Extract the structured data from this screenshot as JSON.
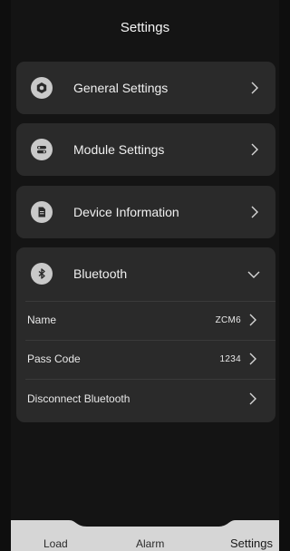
{
  "header": {
    "title": "Settings"
  },
  "menu": {
    "general": {
      "label": "General Settings",
      "icon": "gear-icon"
    },
    "module": {
      "label": "Module Settings",
      "icon": "toggle-icon"
    },
    "device": {
      "label": "Device Information",
      "icon": "document-icon"
    },
    "bluetooth": {
      "label": "Bluetooth",
      "icon": "bluetooth-icon",
      "expanded": true,
      "items": [
        {
          "label": "Name",
          "value": "ZCM6"
        },
        {
          "label": "Pass Code",
          "value": "1234"
        },
        {
          "label": "Disconnect Bluetooth",
          "value": ""
        }
      ]
    }
  },
  "tabs": [
    {
      "label": "Load",
      "active": false
    },
    {
      "label": "Alarm",
      "active": false
    },
    {
      "label": "Settings",
      "active": true
    }
  ],
  "colors": {
    "card": "#2a2a2a",
    "background": "#141414",
    "tabbar": "#d6d6d6",
    "icon": "#c9c9c9"
  }
}
